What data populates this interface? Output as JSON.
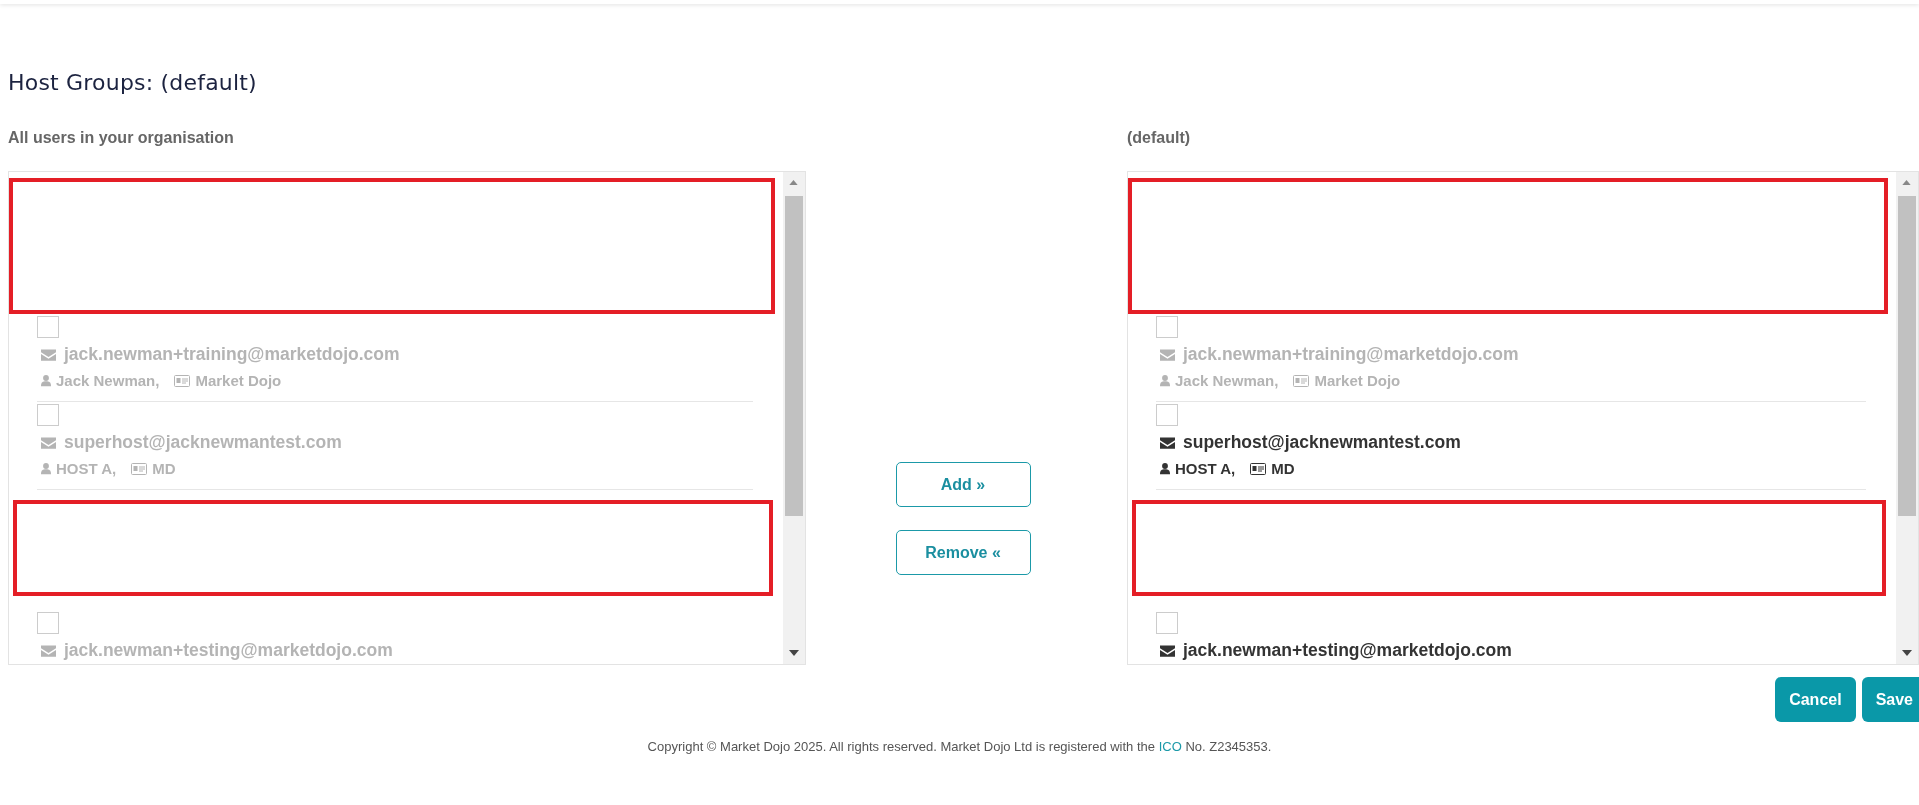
{
  "page": {
    "title": "Host Groups: (default)"
  },
  "lists": [
    {
      "label": "All users in your organisation",
      "items": [
        {
          "kind": "redacted"
        },
        {
          "kind": "user",
          "email": "jack.newman+training@marketdojo.com",
          "name": "Jack Newman,",
          "company": "Market Dojo",
          "disabled": true,
          "checked": false
        },
        {
          "kind": "user",
          "email": "superhost@jacknewmantest.com",
          "name": "HOST A,",
          "company": "MD",
          "disabled": true,
          "checked": false
        },
        {
          "kind": "redacted"
        },
        {
          "kind": "user",
          "email": "jack.newman+testing@marketdojo.com",
          "disabled": true,
          "checked": false
        }
      ]
    },
    {
      "label": "(default)",
      "items": [
        {
          "kind": "redacted"
        },
        {
          "kind": "user",
          "email": "jack.newman+training@marketdojo.com",
          "name": "Jack Newman,",
          "company": "Market Dojo",
          "disabled": true,
          "checked": false
        },
        {
          "kind": "user",
          "email": "superhost@jacknewmantest.com",
          "name": "HOST A,",
          "company": "MD",
          "disabled": false,
          "checked": false
        },
        {
          "kind": "redacted"
        },
        {
          "kind": "user",
          "email": "jack.newman+testing@marketdojo.com",
          "disabled": false,
          "checked": false
        }
      ]
    }
  ],
  "transfer_buttons": [
    {
      "label": "Add »"
    },
    {
      "label": "Remove «"
    }
  ],
  "actions": [
    {
      "label": "Cancel"
    },
    {
      "label": "Save"
    }
  ],
  "footer": {
    "text": "Copyright © Market Dojo 2025. All rights reserved. Market Dojo Ltd is registered with the",
    "link": "ICO",
    "after": "No. Z2345353."
  }
}
